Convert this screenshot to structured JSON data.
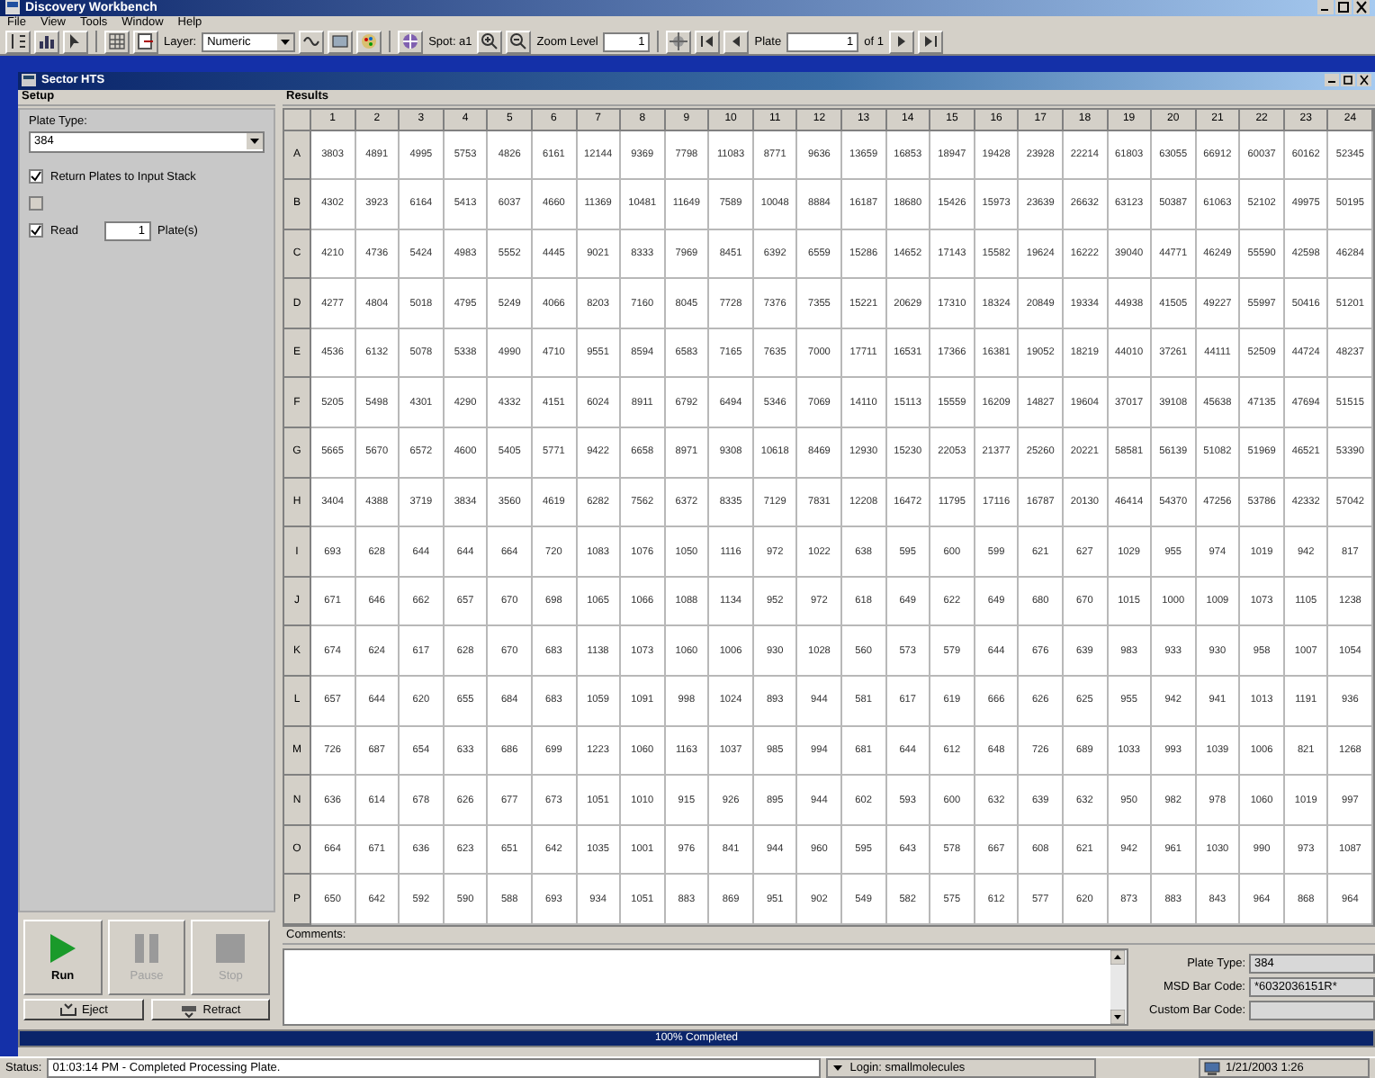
{
  "window": {
    "title": "Discovery Workbench"
  },
  "menu": [
    "File",
    "View",
    "Tools",
    "Window",
    "Help"
  ],
  "toolbar": {
    "layer_label": "Layer:",
    "layer_value": "Numeric",
    "spot": "Spot: a1",
    "zoom_label": "Zoom Level",
    "zoom_value": "1",
    "plate_label": "Plate",
    "plate_value": "1",
    "plate_of": "of 1"
  },
  "child_window": {
    "title": "Sector HTS"
  },
  "setup": {
    "header": "Setup",
    "plate_type_label": "Plate Type:",
    "plate_type": "384",
    "checks": [
      {
        "label": "Return Plates to Input Stack",
        "checked": true,
        "disabled": false
      },
      {
        "checked": false,
        "disabled": true
      }
    ],
    "read": {
      "label": "Read",
      "checked": true,
      "value": "1",
      "suffix": "Plate(s)"
    },
    "run_buttons": [
      {
        "label": "Run",
        "kind": "play",
        "disabled": false
      },
      {
        "label": "Pause",
        "kind": "pause",
        "disabled": true
      },
      {
        "label": "Stop",
        "kind": "stop",
        "disabled": true
      }
    ],
    "plate_buttons": [
      {
        "label": "Eject",
        "kind": "eject"
      },
      {
        "label": "Retract",
        "kind": "retract"
      }
    ]
  },
  "results": {
    "header": "Results",
    "columns": [
      "1",
      "2",
      "3",
      "4",
      "5",
      "6",
      "7",
      "8",
      "9",
      "10",
      "11",
      "12",
      "13",
      "14",
      "15",
      "16",
      "17",
      "18",
      "19",
      "20",
      "21",
      "22",
      "23",
      "24"
    ],
    "rows": [
      {
        "label": "A",
        "values": [
          "3803",
          "4891",
          "4995",
          "5753",
          "4826",
          "6161",
          "12144",
          "9369",
          "7798",
          "11083",
          "8771",
          "9636",
          "13659",
          "16853",
          "18947",
          "19428",
          "23928",
          "22214",
          "61803",
          "63055",
          "66912",
          "60037",
          "60162",
          "52345"
        ]
      },
      {
        "label": "B",
        "values": [
          "4302",
          "3923",
          "6164",
          "5413",
          "6037",
          "4660",
          "11369",
          "10481",
          "11649",
          "7589",
          "10048",
          "8884",
          "16187",
          "18680",
          "15426",
          "15973",
          "23639",
          "26632",
          "63123",
          "50387",
          "61063",
          "52102",
          "49975",
          "50195"
        ]
      },
      {
        "label": "C",
        "values": [
          "4210",
          "4736",
          "5424",
          "4983",
          "5552",
          "4445",
          "9021",
          "8333",
          "7969",
          "8451",
          "6392",
          "6559",
          "15286",
          "14652",
          "17143",
          "15582",
          "19624",
          "16222",
          "39040",
          "44771",
          "46249",
          "55590",
          "42598",
          "46284"
        ]
      },
      {
        "label": "D",
        "values": [
          "4277",
          "4804",
          "5018",
          "4795",
          "5249",
          "4066",
          "8203",
          "7160",
          "8045",
          "7728",
          "7376",
          "7355",
          "15221",
          "20629",
          "17310",
          "18324",
          "20849",
          "19334",
          "44938",
          "41505",
          "49227",
          "55997",
          "50416",
          "51201"
        ]
      },
      {
        "label": "E",
        "values": [
          "4536",
          "6132",
          "5078",
          "5338",
          "4990",
          "4710",
          "9551",
          "8594",
          "6583",
          "7165",
          "7635",
          "7000",
          "17711",
          "16531",
          "17366",
          "16381",
          "19052",
          "18219",
          "44010",
          "37261",
          "44111",
          "52509",
          "44724",
          "48237"
        ]
      },
      {
        "label": "F",
        "values": [
          "5205",
          "5498",
          "4301",
          "4290",
          "4332",
          "4151",
          "6024",
          "8911",
          "6792",
          "6494",
          "5346",
          "7069",
          "14110",
          "15113",
          "15559",
          "16209",
          "14827",
          "19604",
          "37017",
          "39108",
          "45638",
          "47135",
          "47694",
          "51515"
        ]
      },
      {
        "label": "G",
        "values": [
          "5665",
          "5670",
          "6572",
          "4600",
          "5405",
          "5771",
          "9422",
          "6658",
          "8971",
          "9308",
          "10618",
          "8469",
          "12930",
          "15230",
          "22053",
          "21377",
          "25260",
          "20221",
          "58581",
          "56139",
          "51082",
          "51969",
          "46521",
          "53390"
        ]
      },
      {
        "label": "H",
        "values": [
          "3404",
          "4388",
          "3719",
          "3834",
          "3560",
          "4619",
          "6282",
          "7562",
          "6372",
          "8335",
          "7129",
          "7831",
          "12208",
          "16472",
          "11795",
          "17116",
          "16787",
          "20130",
          "46414",
          "54370",
          "47256",
          "53786",
          "42332",
          "57042"
        ]
      },
      {
        "label": "I",
        "values": [
          "693",
          "628",
          "644",
          "644",
          "664",
          "720",
          "1083",
          "1076",
          "1050",
          "1116",
          "972",
          "1022",
          "638",
          "595",
          "600",
          "599",
          "621",
          "627",
          "1029",
          "955",
          "974",
          "1019",
          "942",
          "817"
        ]
      },
      {
        "label": "J",
        "values": [
          "671",
          "646",
          "662",
          "657",
          "670",
          "698",
          "1065",
          "1066",
          "1088",
          "1134",
          "952",
          "972",
          "618",
          "649",
          "622",
          "649",
          "680",
          "670",
          "1015",
          "1000",
          "1009",
          "1073",
          "1105",
          "1238"
        ]
      },
      {
        "label": "K",
        "values": [
          "674",
          "624",
          "617",
          "628",
          "670",
          "683",
          "1138",
          "1073",
          "1060",
          "1006",
          "930",
          "1028",
          "560",
          "573",
          "579",
          "644",
          "676",
          "639",
          "983",
          "933",
          "930",
          "958",
          "1007",
          "1054"
        ]
      },
      {
        "label": "L",
        "values": [
          "657",
          "644",
          "620",
          "655",
          "684",
          "683",
          "1059",
          "1091",
          "998",
          "1024",
          "893",
          "944",
          "581",
          "617",
          "619",
          "666",
          "626",
          "625",
          "955",
          "942",
          "941",
          "1013",
          "1191",
          "936"
        ]
      },
      {
        "label": "M",
        "values": [
          "726",
          "687",
          "654",
          "633",
          "686",
          "699",
          "1223",
          "1060",
          "1163",
          "1037",
          "985",
          "994",
          "681",
          "644",
          "612",
          "648",
          "726",
          "689",
          "1033",
          "993",
          "1039",
          "1006",
          "821",
          "1268"
        ]
      },
      {
        "label": "N",
        "values": [
          "636",
          "614",
          "678",
          "626",
          "677",
          "673",
          "1051",
          "1010",
          "915",
          "926",
          "895",
          "944",
          "602",
          "593",
          "600",
          "632",
          "639",
          "632",
          "950",
          "982",
          "978",
          "1060",
          "1019",
          "997"
        ]
      },
      {
        "label": "O",
        "values": [
          "664",
          "671",
          "636",
          "623",
          "651",
          "642",
          "1035",
          "1001",
          "976",
          "841",
          "944",
          "960",
          "595",
          "643",
          "578",
          "667",
          "608",
          "621",
          "942",
          "961",
          "1030",
          "990",
          "973",
          "1087"
        ]
      },
      {
        "label": "P",
        "values": [
          "650",
          "642",
          "592",
          "590",
          "588",
          "693",
          "934",
          "1051",
          "883",
          "869",
          "951",
          "902",
          "549",
          "582",
          "575",
          "612",
          "577",
          "620",
          "873",
          "883",
          "843",
          "964",
          "868",
          "964"
        ]
      }
    ]
  },
  "comments": {
    "label": "Comments:"
  },
  "plate_info": [
    {
      "label": "Plate Type:",
      "value": "384"
    },
    {
      "label": "MSD Bar Code:",
      "value": "*6032036151R*"
    },
    {
      "label": "Custom Bar Code:"
    }
  ],
  "progress": {
    "text": "100% Completed",
    "level": 1
  },
  "status_bar": {
    "label": "Status:",
    "message": "01:03:14 PM - Completed Processing Plate.",
    "login": "Login: smallmolecules",
    "datetime": "1/21/2003 1:26"
  }
}
